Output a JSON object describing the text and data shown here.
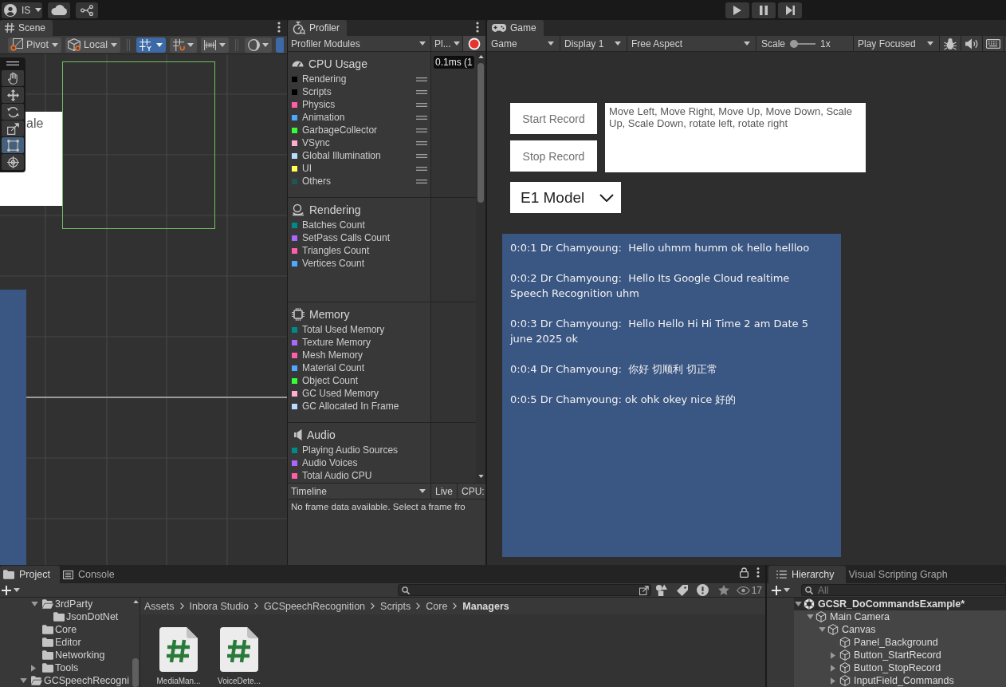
{
  "top_bar": {
    "account": "IS"
  },
  "scene": {
    "tabs": [
      {
        "label": "Scene",
        "selected": true
      }
    ],
    "toolbar": {
      "pivot": "Pivot",
      "space": "Local",
      "toggles": [
        {
          "kind": "grid-snap",
          "on": true
        },
        {
          "kind": "increment-snap",
          "on": false
        },
        {
          "kind": "grid-lines",
          "on": false
        },
        {
          "kind": "draw-mode",
          "on": false
        },
        {
          "kind": "view-mode",
          "on": true
        }
      ]
    },
    "tools": [
      {
        "kind": "hand",
        "selected": false
      },
      {
        "kind": "move",
        "selected": false
      },
      {
        "kind": "rotate",
        "selected": false
      },
      {
        "kind": "scale",
        "selected": false
      },
      {
        "kind": "rect",
        "selected": true
      },
      {
        "kind": "transform",
        "selected": false
      }
    ],
    "viewport": {
      "label_fragment": "ale"
    }
  },
  "profiler": {
    "tabs": [
      {
        "label": "Profiler",
        "selected": true
      }
    ],
    "modules_dropdown": "Profiler Modules",
    "mode_dropdown": "Pl...",
    "frame_time": "0.1ms (1",
    "modules": [
      {
        "kind": "cpu",
        "title": "CPU Usage",
        "draggable": true,
        "items": [
          {
            "name": "Rendering",
            "color": "#000000"
          },
          {
            "name": "Scripts",
            "color": "#000000"
          },
          {
            "name": "Physics",
            "color": "#ff5fa8"
          },
          {
            "name": "Animation",
            "color": "#4ea8ff"
          },
          {
            "name": "GarbageCollector",
            "color": "#33ff33"
          },
          {
            "name": "VSync",
            "color": "#ffaed2"
          },
          {
            "name": "Global Illumination",
            "color": "#b8dcff"
          },
          {
            "name": "UI",
            "color": "#ffff55"
          },
          {
            "name": "Others",
            "color": "#1f5552"
          }
        ]
      },
      {
        "kind": "rendering",
        "title": "Rendering",
        "items": [
          {
            "name": "Batches Count",
            "color": "#008b8b"
          },
          {
            "name": "SetPass Calls Count",
            "color": "#aa66ff"
          },
          {
            "name": "Triangles Count",
            "color": "#ff5fa8"
          },
          {
            "name": "Vertices Count",
            "color": "#4ea8ff"
          }
        ]
      },
      {
        "kind": "memory",
        "title": "Memory",
        "items": [
          {
            "name": "Total Used Memory",
            "color": "#008b8b"
          },
          {
            "name": "Texture Memory",
            "color": "#aa66ff"
          },
          {
            "name": "Mesh Memory",
            "color": "#ff5fa8"
          },
          {
            "name": "Material Count",
            "color": "#4ea8ff"
          },
          {
            "name": "Object Count",
            "color": "#33ff33"
          },
          {
            "name": "GC Used Memory",
            "color": "#ffaed2"
          },
          {
            "name": "GC Allocated In Frame",
            "color": "#b8dcff"
          }
        ]
      },
      {
        "kind": "audio",
        "title": "Audio",
        "items": [
          {
            "name": "Playing Audio Sources",
            "color": "#008b8b"
          },
          {
            "name": "Audio Voices",
            "color": "#aa66ff"
          },
          {
            "name": "Total Audio CPU",
            "color": "#ff5fa8"
          }
        ]
      }
    ],
    "bottom_bar": {
      "view": "Timeline",
      "live": "Live",
      "cpu": "CPU:",
      "message": "No frame data available. Select a frame fro"
    }
  },
  "game": {
    "tabs": [
      {
        "label": "Game",
        "selected": true
      }
    ],
    "toolbar": {
      "view": "Game",
      "display": "Display 1",
      "aspect": "Free Aspect",
      "scale_label": "Scale",
      "scale": {
        "level": 0
      },
      "scale_value": "1x",
      "play_mode": "Play Focused"
    },
    "buttons": [
      "Start Record",
      "Stop Record"
    ],
    "commands_field": {
      "value": "Move Left, Move Right, Move Up, Move Down, Scale Up, Scale Down, rotate left, rotate right"
    },
    "model_dropdown": "E1 Model",
    "transcript": [
      "0:0:1 Dr Chamyoung:  Hello uhmm humm ok hello hellloo",
      "0:0:2 Dr Chamyoung:  Hello Its Google Cloud realtime Speech Recognition uhm",
      "0:0:3 Dr Chamyoung:  Hello Hello Hi Hi Time 2 am Date 5 june 2025 ok",
      "0:0:4 Dr Chamyoung:  你好 切顺利 切正常",
      "0:0:5 Dr Chamyoung: ok ohk okey nice 好的"
    ]
  },
  "project": {
    "tabs": [
      {
        "label": "Project",
        "selected": true
      },
      {
        "label": "Console",
        "selected": false
      }
    ],
    "hidden_count": "17",
    "tree": [
      {
        "children": [
          {
            "name": "3rdParty",
            "expanded": true,
            "children": [
              {
                "name": "JsonDotNet"
              }
            ]
          },
          {
            "name": "Core"
          },
          {
            "name": "Editor"
          },
          {
            "name": "Networking"
          },
          {
            "name": "Tools",
            "expanded": false
          }
        ]
      },
      {
        "name": "GCSpeechRecogni",
        "expanded": true
      }
    ],
    "breadcrumb": [
      {
        "label": "Assets",
        "selected": false
      },
      {
        "label": "Inbora Studio",
        "selected": false
      },
      {
        "label": "GCSpeechRecognition",
        "selected": false
      },
      {
        "label": "Scripts",
        "selected": false
      },
      {
        "label": "Core",
        "selected": false
      },
      {
        "label": "Managers",
        "selected": true
      }
    ],
    "files": [
      "MediaMan...",
      "VoiceDete..."
    ]
  },
  "hierarchy": {
    "tabs": [
      {
        "label": "Hierarchy",
        "selected": true
      },
      {
        "label": "Visual Scripting Graph",
        "selected": false
      }
    ],
    "search": {
      "placeholder": "All"
    },
    "tree": [
      {
        "name": "GCSR_DoCommandsExample*",
        "kind": "scene",
        "expanded": true,
        "children": [
          {
            "name": "Main Camera",
            "kind": "object",
            "expanded": true,
            "children": [
              {
                "name": "Canvas",
                "kind": "object",
                "expanded": true,
                "children": [
                  {
                    "name": "Panel_Background",
                    "kind": "object"
                  },
                  {
                    "name": "Button_StartRecord",
                    "kind": "object",
                    "expanded": false
                  },
                  {
                    "name": "Button_StopRecord",
                    "kind": "object",
                    "expanded": false
                  },
                  {
                    "name": "InputField_Commands",
                    "kind": "object",
                    "expanded": false
                  }
                ]
              }
            ]
          }
        ]
      }
    ]
  }
}
